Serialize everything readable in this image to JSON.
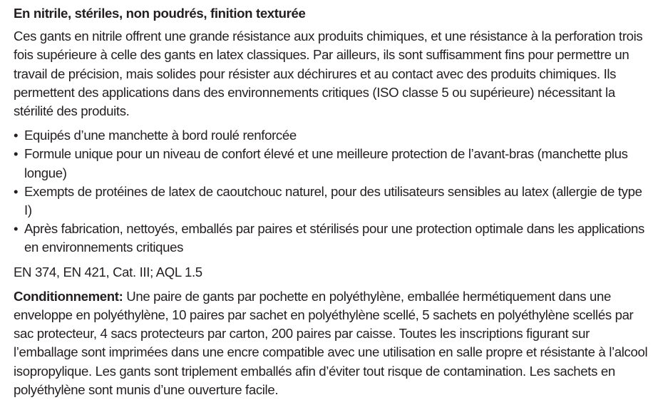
{
  "document": {
    "title": "En nitrile, stériles, non poudrés, finition texturée",
    "intro": "Ces gants en nitrile offrent une grande résistance aux produits chimiques, et une résistance à la perforation trois fois supérieure à celle des gants en latex classiques. Par ailleurs, ils sont suffisamment fins pour permettre un travail de précision, mais solides pour résister aux déchirures et au contact avec des produits chimiques. Ils permettent des applications dans des environnements critiques (ISO classe 5 ou supérieure) nécessitant la stérilité des produits.",
    "bullet_symbol": "•",
    "bullets": [
      "Equipés d’une manchette à bord roulé renforcée",
      "Formule unique pour un niveau de confort élevé et une meilleure protection de l’avant-bras (manchette plus longue)",
      "Exempts de protéines de latex de caoutchouc naturel, pour des utilisateurs sensibles au latex (allergie de type I)",
      "Après fabrication, nettoyés, emballés par paires et stérilisés pour une protection optimale dans les applications en environnements critiques"
    ],
    "norms": "EN 374, EN 421, Cat. III; AQL 1.5",
    "packaging_label": "Conditionnement:",
    "packaging_text": " Une paire de gants par pochette en polyéthylène, emballée hermétiquement dans une enveloppe en polyéthylène, 10 paires par sachet en polyéthylène scellé, 5 sachets en polyéthylène scellés par sac protecteur, 4 sacs protecteurs par carton, 200 paires par caisse. Toutes les inscriptions figurant sur l’emballage sont imprimées dans une encre compatible avec une utilisation en salle propre et résistante à l’alcool isopropylique. Les gants sont triplement emballés afin d’éviter tout risque de contamination. Les sachets en polyéthylène sont munis d’une ouverture facile."
  }
}
